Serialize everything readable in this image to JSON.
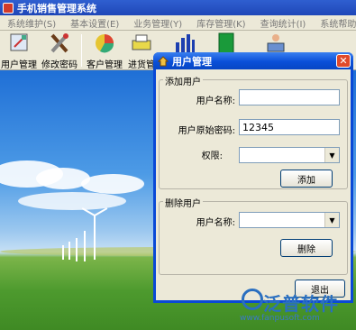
{
  "app": {
    "title": "手机销售管理系统"
  },
  "menu": [
    {
      "label": "系统维护(S)"
    },
    {
      "label": "基本设置(E)"
    },
    {
      "label": "业务管理(Y)"
    },
    {
      "label": "库存管理(K)"
    },
    {
      "label": "查询统计(I)"
    },
    {
      "label": "系统帮助(H)"
    }
  ],
  "toolbar": {
    "user_manage": "用户管理",
    "change_password": "修改密码",
    "customer_manage": "客户管理",
    "purchase_manage": "进货管"
  },
  "dialog": {
    "title": "用户管理",
    "close_glyph": "✕",
    "add_group": {
      "legend": "添加用户",
      "username_label": "用户名称:",
      "username_value": "",
      "password_label": "用户原始密码:",
      "password_value": "12345",
      "role_label": "权限:",
      "role_value": "",
      "add_button": "添加"
    },
    "delete_group": {
      "legend": "删除用户",
      "username_label": "用户名称:",
      "username_value": "",
      "delete_button": "删除"
    },
    "exit_button": "退出"
  },
  "watermark": {
    "brand": "泛普软件",
    "url": "www.fanpusoft.com"
  },
  "colors": {
    "title_blue": "#0a49d6",
    "close_red": "#e04a2a",
    "panel": "#ece9d8"
  }
}
